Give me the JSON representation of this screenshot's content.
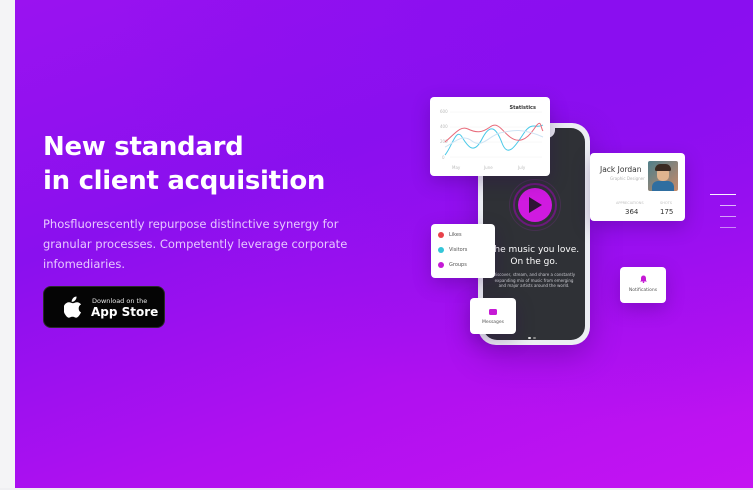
{
  "hero": {
    "title_line1": "New standard",
    "title_line2": "in client acquisition",
    "subtitle": "Phosfluorescently repurpose distinctive synergy for granular processes. Competently leverage corporate infomediaries.",
    "appstore_small": "Download on the",
    "appstore_big": "App Store"
  },
  "phone": {
    "music_title": "The music you love. On the go.",
    "music_desc": "Discover, stream, and share a constantly expanding mix of music from emerging and major artists around the world."
  },
  "stats": {
    "title": "Statistics",
    "y_ticks": [
      "600",
      "400",
      "200",
      "0"
    ],
    "x_ticks": [
      "May",
      "June",
      "July"
    ]
  },
  "profile": {
    "name": "Jack Jordan",
    "role": "Graphic Designer",
    "label_left": "APPRECIATIONS",
    "value_left": "364",
    "label_right": "SHOTS",
    "value_right": "175"
  },
  "lists": {
    "items": [
      {
        "label": "Likes",
        "color": "#e8424a"
      },
      {
        "label": "Visitors",
        "color": "#34c6d8"
      },
      {
        "label": "Groups",
        "color": "#c51ad5"
      }
    ]
  },
  "messages": {
    "label": "Messages"
  },
  "notifications": {
    "label": "Notifications"
  },
  "colors": {
    "accent": "#c51ad5",
    "hero_purple": "#9a12f0",
    "hero_magenta": "#c513f2"
  }
}
